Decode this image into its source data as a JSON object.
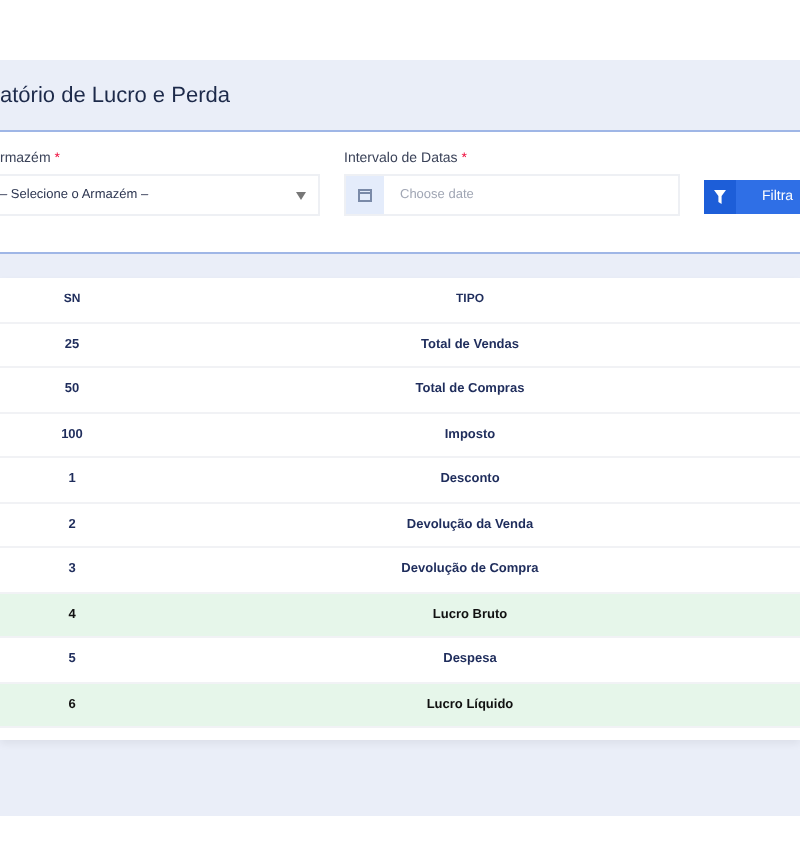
{
  "title": "atório de Lucro e Perda",
  "filters": {
    "warehouse": {
      "label": "rmazém",
      "required": "*",
      "placeholder": "– Selecione o Armazém –"
    },
    "dates": {
      "label": "Intervalo de Datas",
      "required": "*",
      "placeholder": "Choose date"
    },
    "button": "Filtra"
  },
  "table": {
    "columns": [
      "SN",
      "TIPO"
    ],
    "rows": [
      {
        "sn": "25",
        "tipo": "Total de Vendas",
        "highlight": false
      },
      {
        "sn": "50",
        "tipo": "Total de Compras",
        "highlight": false
      },
      {
        "sn": "100",
        "tipo": "Imposto",
        "highlight": false
      },
      {
        "sn": "1",
        "tipo": "Desconto",
        "highlight": false
      },
      {
        "sn": "2",
        "tipo": "Devolução da Venda",
        "highlight": false
      },
      {
        "sn": "3",
        "tipo": "Devolução de Compra",
        "highlight": false
      },
      {
        "sn": "4",
        "tipo": "Lucro Bruto",
        "highlight": true
      },
      {
        "sn": "5",
        "tipo": "Despesa",
        "highlight": false
      },
      {
        "sn": "6",
        "tipo": "Lucro Líquido",
        "highlight": true
      }
    ]
  }
}
